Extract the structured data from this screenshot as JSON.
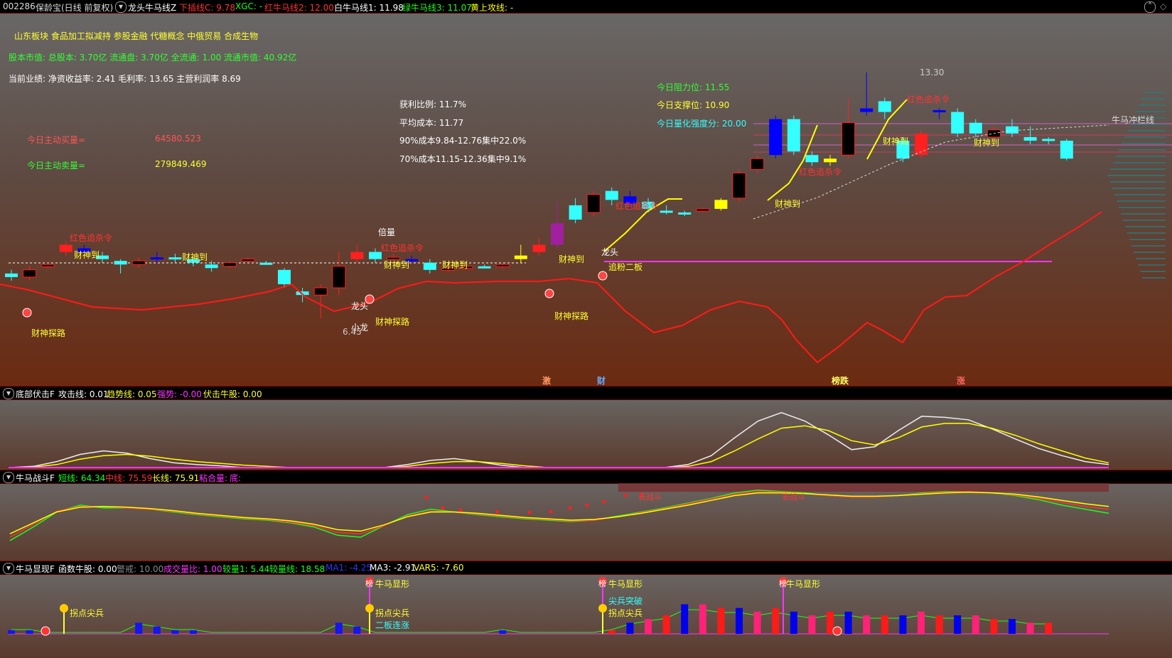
{
  "main": {
    "code": "002286",
    "name": "保龄宝(日线 前复权)",
    "indicator": "龙头牛马线Z",
    "legend": [
      {
        "text": "下插线C: 9.78",
        "color": "#ff3333"
      },
      {
        "text": "XGC: -",
        "color": "#19ff19"
      },
      {
        "text": "红牛马线2: 12.00",
        "color": "#ff3333"
      },
      {
        "text": "白牛马线1: 11.98",
        "color": "#ffffff"
      },
      {
        "text": "绿牛马线3: 11.07",
        "color": "#19ff19"
      },
      {
        "text": "黄上攻线: -",
        "color": "#ffff00"
      }
    ],
    "info": {
      "sectors": "山东板块  食品加工拟减持 参股金融  代糖概念 中俄贸易 合成生物",
      "capital": "股本市值: 总股本: 3.70亿 流通盘: 3.70亿 全流通: 1.00 流通市值: 40.92亿",
      "perf": "当前业绩: 净资收益率: 2.41 毛利率: 13.65 主营利润率 8.69",
      "buy_label": "今日主动买量=",
      "buy_value": "64580.523",
      "sell_label": "今日主动卖量=",
      "sell_value": "279849.469",
      "profit_ratio": "获利比例: 11.7%",
      "avg_cost": "平均成本: 11.77",
      "cost90": "90%成本9.84-12.76集中22.0%",
      "cost70": "70%成本11.15-12.36集中9.1%",
      "resist": "今日阻力位: 11.55",
      "support": "今日支撑位: 10.90",
      "strength": "今日量化强度分: 20.00"
    },
    "annotations": {
      "caishendao": "财神到",
      "caishentanlu": "财神探路",
      "hongse": "红色追杀令",
      "longtou": "龙头",
      "xiaolong": "小龙",
      "beiliang": "倍量",
      "zhuifen": "追粉二板",
      "niumachonglan": "牛马冲栏线",
      "high_price": "13.30",
      "low_price": "6.45",
      "markers": [
        "激",
        "财",
        "榜跌",
        "涨"
      ]
    }
  },
  "sub1": {
    "title": "底部伏击F",
    "legend": [
      {
        "text": "攻击线: 0.01",
        "color": "#ffffff"
      },
      {
        "text": "趋势线: 0.05",
        "color": "#ffff00"
      },
      {
        "text": "强势: -0.00",
        "color": "#ff33ff"
      },
      {
        "text": "伏击牛股: 0.00",
        "color": "#ffff00"
      }
    ]
  },
  "sub2": {
    "title": "牛马战斗F",
    "legend": [
      {
        "text": "短线: 64.34",
        "color": "#19ff19"
      },
      {
        "text": "中线: 75.59",
        "color": "#ff3333"
      },
      {
        "text": "长线: 75.91",
        "color": "#ffff00"
      },
      {
        "text": "粘合量:",
        "color": "#ff33ff"
      },
      {
        "text": "底:",
        "color": "#ff33ff"
      }
    ],
    "label": "去战斗"
  },
  "sub3": {
    "title": "牛马显现F",
    "legend": [
      {
        "text": "函数牛股: 0.00",
        "color": "#ffffff"
      },
      {
        "text": "警戒: 10.00",
        "color": "#888888"
      },
      {
        "text": "成交量比: 1.00",
        "color": "#ff33ff"
      },
      {
        "text": "较量1: 5.44",
        "color": "#19ff19"
      },
      {
        "text": "较量线: 18.58",
        "color": "#19ff19"
      },
      {
        "text": "MA1: -4.25",
        "color": "#3333ff"
      },
      {
        "text": "MA3: -2.91",
        "color": "#ffffff"
      },
      {
        "text": "VAR5: -7.60",
        "color": "#ffff00"
      }
    ],
    "labels": {
      "niuma": "牛马显形",
      "guaidian": "拐点尖兵",
      "erban": "二板连涨",
      "jianbing": "尖兵突破",
      "bang": "榜"
    }
  },
  "chart_data": [
    {
      "type": "candlestick",
      "title": "保龄宝(日线 前复权)",
      "y_range": [
        6.45,
        13.3
      ],
      "candles": [
        {
          "o": 7.7,
          "c": 7.6,
          "h": 7.8,
          "l": 7.5,
          "color": "cyan"
        },
        {
          "o": 7.6,
          "c": 7.8,
          "h": 7.9,
          "l": 7.5,
          "color": "black"
        },
        {
          "o": 7.9,
          "c": 7.95,
          "h": 8.0,
          "l": 7.85,
          "color": "black"
        },
        {
          "o": 8.3,
          "c": 8.5,
          "h": 8.6,
          "l": 8.2,
          "color": "red"
        },
        {
          "o": 8.4,
          "c": 8.3,
          "h": 8.5,
          "l": 8.2,
          "color": "blue"
        },
        {
          "o": 8.2,
          "c": 8.1,
          "h": 8.3,
          "l": 8.0,
          "color": "cyan"
        },
        {
          "o": 8.05,
          "c": 7.95,
          "h": 8.1,
          "l": 7.7,
          "color": "cyan"
        },
        {
          "o": 7.95,
          "c": 8.05,
          "h": 8.15,
          "l": 7.85,
          "color": "black"
        },
        {
          "o": 8.1,
          "c": 8.15,
          "h": 8.3,
          "l": 8.0,
          "color": "blue"
        },
        {
          "o": 8.15,
          "c": 8.1,
          "h": 8.25,
          "l": 8.0,
          "color": "cyan"
        },
        {
          "o": 8.1,
          "c": 8.0,
          "h": 8.15,
          "l": 7.9,
          "color": "cyan"
        },
        {
          "o": 7.95,
          "c": 7.85,
          "h": 8.05,
          "l": 7.75,
          "color": "cyan"
        },
        {
          "o": 7.9,
          "c": 8.0,
          "h": 8.05,
          "l": 7.85,
          "color": "black"
        },
        {
          "o": 8.05,
          "c": 8.1,
          "h": 8.15,
          "l": 8.0,
          "color": "black"
        },
        {
          "o": 8.0,
          "c": 8.0,
          "h": 8.05,
          "l": 7.95,
          "color": "cyan"
        },
        {
          "o": 7.8,
          "c": 7.4,
          "h": 7.85,
          "l": 7.3,
          "color": "cyan"
        },
        {
          "o": 7.2,
          "c": 7.1,
          "h": 7.3,
          "l": 6.9,
          "color": "cyan"
        },
        {
          "o": 7.1,
          "c": 7.3,
          "h": 7.4,
          "l": 6.45,
          "color": "black"
        },
        {
          "o": 7.3,
          "c": 7.9,
          "h": 8.3,
          "l": 7.1,
          "color": "black"
        },
        {
          "o": 8.1,
          "c": 8.3,
          "h": 8.5,
          "l": 8.0,
          "color": "red"
        },
        {
          "o": 8.3,
          "c": 8.1,
          "h": 8.4,
          "l": 8.0,
          "color": "cyan"
        },
        {
          "o": 8.1,
          "c": 8.15,
          "h": 8.25,
          "l": 8.05,
          "color": "black"
        },
        {
          "o": 8.1,
          "c": 8.05,
          "h": 8.2,
          "l": 8.0,
          "color": "blue"
        },
        {
          "o": 8.0,
          "c": 7.8,
          "h": 8.1,
          "l": 7.7,
          "color": "cyan"
        },
        {
          "o": 7.8,
          "c": 7.85,
          "h": 7.9,
          "l": 7.75,
          "color": "black"
        },
        {
          "o": 7.85,
          "c": 7.9,
          "h": 7.95,
          "l": 7.8,
          "color": "black"
        },
        {
          "o": 7.9,
          "c": 7.88,
          "h": 7.95,
          "l": 7.85,
          "color": "cyan"
        },
        {
          "o": 7.9,
          "c": 7.95,
          "h": 8.0,
          "l": 7.85,
          "color": "black"
        },
        {
          "o": 8.1,
          "c": 8.2,
          "h": 8.5,
          "l": 8.0,
          "color": "yellow"
        },
        {
          "o": 8.3,
          "c": 8.5,
          "h": 8.7,
          "l": 8.2,
          "color": "red"
        },
        {
          "o": 8.5,
          "c": 9.1,
          "h": 9.7,
          "l": 8.4,
          "color": "purple"
        },
        {
          "o": 9.2,
          "c": 9.6,
          "h": 9.8,
          "l": 9.1,
          "color": "cyan"
        },
        {
          "o": 9.4,
          "c": 9.9,
          "h": 10.0,
          "l": 9.3,
          "color": "black"
        },
        {
          "o": 10.0,
          "c": 9.75,
          "h": 10.1,
          "l": 9.6,
          "color": "cyan"
        },
        {
          "o": 9.65,
          "c": 9.85,
          "h": 10.0,
          "l": 9.5,
          "color": "blue"
        },
        {
          "o": 9.7,
          "c": 9.5,
          "h": 9.8,
          "l": 9.4,
          "color": "cyan"
        },
        {
          "o": 9.45,
          "c": 9.4,
          "h": 9.6,
          "l": 9.35,
          "color": "cyan"
        },
        {
          "o": 9.4,
          "c": 9.35,
          "h": 9.45,
          "l": 9.3,
          "color": "cyan"
        },
        {
          "o": 9.45,
          "c": 9.5,
          "h": 9.55,
          "l": 9.4,
          "color": "black"
        },
        {
          "o": 9.5,
          "c": 9.75,
          "h": 9.8,
          "l": 9.45,
          "color": "yellow"
        },
        {
          "o": 9.8,
          "c": 10.5,
          "h": 10.6,
          "l": 9.7,
          "color": "black"
        },
        {
          "o": 10.6,
          "c": 10.9,
          "h": 11.0,
          "l": 10.5,
          "color": "black"
        },
        {
          "o": 11.0,
          "c": 12.0,
          "h": 12.1,
          "l": 10.9,
          "color": "blue"
        },
        {
          "o": 12.0,
          "c": 11.1,
          "h": 12.1,
          "l": 11.0,
          "color": "cyan"
        },
        {
          "o": 11.0,
          "c": 10.8,
          "h": 11.1,
          "l": 10.7,
          "color": "cyan"
        },
        {
          "o": 10.9,
          "c": 10.8,
          "h": 11.0,
          "l": 10.7,
          "color": "yellow"
        },
        {
          "o": 11.0,
          "c": 11.9,
          "h": 12.6,
          "l": 10.9,
          "color": "black"
        },
        {
          "o": 12.2,
          "c": 12.3,
          "h": 13.3,
          "l": 12.1,
          "color": "blue"
        },
        {
          "o": 12.5,
          "c": 12.2,
          "h": 12.6,
          "l": 12.0,
          "color": "cyan"
        },
        {
          "o": 11.4,
          "c": 10.9,
          "h": 11.5,
          "l": 10.8,
          "color": "cyan"
        },
        {
          "o": 11.0,
          "c": 11.6,
          "h": 11.7,
          "l": 10.9,
          "color": "red"
        },
        {
          "o": 12.2,
          "c": 12.25,
          "h": 12.3,
          "l": 12.0,
          "color": "blue"
        },
        {
          "o": 12.2,
          "c": 11.6,
          "h": 12.3,
          "l": 11.5,
          "color": "cyan"
        },
        {
          "o": 11.9,
          "c": 11.6,
          "h": 12.0,
          "l": 11.5,
          "color": "cyan"
        },
        {
          "o": 11.7,
          "c": 11.5,
          "h": 11.8,
          "l": 11.4,
          "color": "black"
        },
        {
          "o": 11.8,
          "c": 11.6,
          "h": 12.0,
          "l": 11.5,
          "color": "cyan"
        },
        {
          "o": 11.5,
          "c": 11.4,
          "h": 11.8,
          "l": 11.3,
          "color": "cyan"
        },
        {
          "o": 11.45,
          "c": 11.4,
          "h": 11.5,
          "l": 11.3,
          "color": "cyan"
        },
        {
          "o": 11.4,
          "c": 10.9,
          "h": 11.45,
          "l": 10.85,
          "color": "cyan"
        }
      ]
    },
    {
      "type": "line",
      "name": "底部伏击F",
      "series": [
        {
          "name": "攻击线",
          "color": "#eeeeee",
          "values": [
            0,
            0.02,
            0.1,
            0.22,
            0.28,
            0.24,
            0.15,
            0.08,
            0.05,
            0.03,
            0,
            0,
            0,
            0,
            0,
            0,
            0,
            0.05,
            0.12,
            0.15,
            0.1,
            0.04,
            0,
            0,
            0,
            0,
            0,
            0,
            0,
            0.05,
            0.2,
            0.5,
            0.78,
            0.92,
            0.78,
            0.55,
            0.3,
            0.35,
            0.62,
            0.86,
            0.84,
            0.8,
            0.65,
            0.48,
            0.32,
            0.2,
            0.1,
            0.05
          ]
        },
        {
          "name": "趋势线",
          "color": "#ffff00",
          "values": [
            0,
            0.01,
            0.05,
            0.14,
            0.2,
            0.22,
            0.19,
            0.14,
            0.1,
            0.07,
            0.04,
            0.02,
            0,
            0,
            0,
            0,
            0,
            0.02,
            0.07,
            0.1,
            0.1,
            0.07,
            0.03,
            0,
            0,
            0,
            0,
            0,
            0,
            0.02,
            0.1,
            0.28,
            0.48,
            0.66,
            0.7,
            0.62,
            0.45,
            0.38,
            0.5,
            0.68,
            0.74,
            0.74,
            0.66,
            0.54,
            0.4,
            0.28,
            0.16,
            0.08
          ]
        }
      ]
    },
    {
      "type": "line",
      "name": "牛马战斗F",
      "series": [
        {
          "name": "短线",
          "color": "#19ff19",
          "values": [
            20,
            40,
            62,
            72,
            68,
            68,
            66,
            62,
            58,
            55,
            52,
            50,
            46,
            40,
            28,
            25,
            42,
            58,
            66,
            62,
            58,
            55,
            52,
            50,
            48,
            50,
            56,
            62,
            68,
            75,
            82,
            90,
            94,
            92,
            90,
            86,
            84,
            84,
            86,
            90,
            92,
            92,
            90,
            86,
            80,
            72,
            66,
            60
          ]
        },
        {
          "name": "中线",
          "color": "#ff3333",
          "values": [
            25,
            44,
            63,
            70,
            70,
            68,
            66,
            63,
            59,
            56,
            53,
            51,
            47,
            42,
            32,
            30,
            42,
            56,
            63,
            62,
            59,
            56,
            53,
            51,
            49,
            50,
            55,
            61,
            67,
            74,
            81,
            88,
            92,
            91,
            89,
            86,
            84,
            84,
            86,
            89,
            91,
            92,
            90,
            87,
            82,
            76,
            70,
            66
          ]
        },
        {
          "name": "长线",
          "color": "#ffff00",
          "values": [
            30,
            46,
            62,
            69,
            70,
            69,
            67,
            64,
            60,
            57,
            54,
            52,
            49,
            44,
            36,
            34,
            43,
            55,
            62,
            62,
            60,
            57,
            54,
            52,
            50,
            51,
            55,
            60,
            66,
            72,
            79,
            86,
            90,
            90,
            89,
            87,
            85,
            85,
            86,
            88,
            90,
            91,
            90,
            88,
            84,
            79,
            74,
            70
          ]
        }
      ]
    },
    {
      "type": "bar",
      "name": "牛马显现F",
      "series": [
        {
          "name": "成交量",
          "values": [
            1,
            1,
            0,
            0,
            0,
            0,
            0,
            3,
            2,
            1,
            1,
            0,
            0,
            0,
            0,
            0,
            0,
            0,
            3,
            2,
            0,
            0,
            0,
            0,
            0,
            0,
            0,
            1,
            0,
            0,
            0,
            0,
            0,
            1,
            3,
            4,
            5,
            8,
            8,
            7,
            7,
            6,
            7,
            6,
            5,
            6,
            6,
            5,
            5,
            5,
            6,
            5,
            5,
            5,
            4,
            4,
            3,
            3
          ]
        }
      ]
    }
  ]
}
